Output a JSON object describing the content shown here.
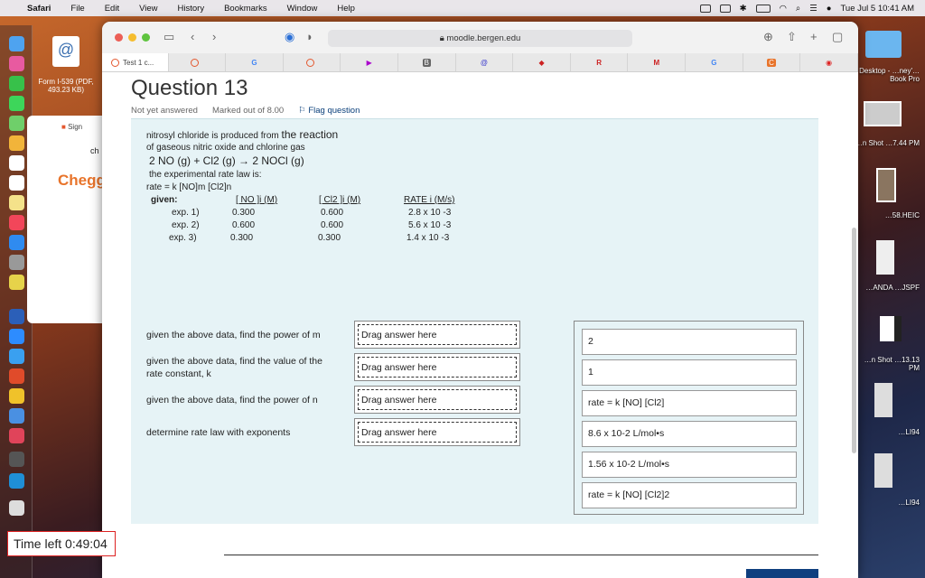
{
  "menubar": {
    "app": "Safari",
    "items": [
      "File",
      "Edit",
      "View",
      "History",
      "Bookmarks",
      "Window",
      "Help"
    ],
    "clock": "Tue Jul 5  10:41 AM"
  },
  "desktop": {
    "file_left": "Form I-539 (PDF, 493.23 KB)",
    "labels": [
      "Desktop - …ney'…Book Pro",
      "…n Shot …7.44 PM",
      "…58.HEIC",
      "…ANDA …JSPF",
      "…n Shot …13.13 PM",
      "…LI94",
      "…LI94"
    ]
  },
  "browser": {
    "url": "moodle.bergen.edu",
    "active_tab": "Test 1 c...",
    "bg_tab_label": "Sign",
    "bg_tab_text": "ch",
    "chegg": "Chegg"
  },
  "question": {
    "title": "Question 13",
    "status": "Not yet answered",
    "marks": "Marked out of 8.00",
    "flag": "Flag question",
    "line1a": "nitrosyl chloride is produced from ",
    "line1b": "the reaction",
    "line2": "of gaseous nitric oxide and chlorine gas",
    "eq": "2 NO (g)  +  Cl2 (g)   →   2 NOCl (g)",
    "line3": "the experimental rate law is:",
    "ratelaw": "rate = k  [NO]m [Cl2]n",
    "given": "given:",
    "hdr_no": "[ NO ]i (M)",
    "hdr_cl": "[ Cl2 ]i (M)",
    "hdr_rate": "RATE i (M/s)",
    "rows": [
      {
        "exp": "exp. 1)",
        "no": "0.300",
        "cl": "0.600",
        "rate": "2.8 x 10 -3"
      },
      {
        "exp": "exp. 2)",
        "no": "0.600",
        "cl": "0.600",
        "rate": "5.6 x 10 -3"
      },
      {
        "exp": "exp. 3)",
        "no": "0.300",
        "cl": "0.300",
        "rate": "1.4 x 10 -3"
      }
    ],
    "prompts": [
      "given the above data, find the power of m",
      "given the above data, find the value of the rate constant, k",
      "given the above data, find the power of n",
      "determine rate law with exponents"
    ],
    "drop_placeholder": "Drag answer here",
    "answers": [
      "2",
      "1",
      "rate = k [NO] [Cl2]",
      "8.6 x 10-2 L/mol•s",
      "1.56 x 10-2 L/mol•s",
      "rate = k [NO] [Cl2]2"
    ]
  },
  "timer": "Time left 0:49:04"
}
